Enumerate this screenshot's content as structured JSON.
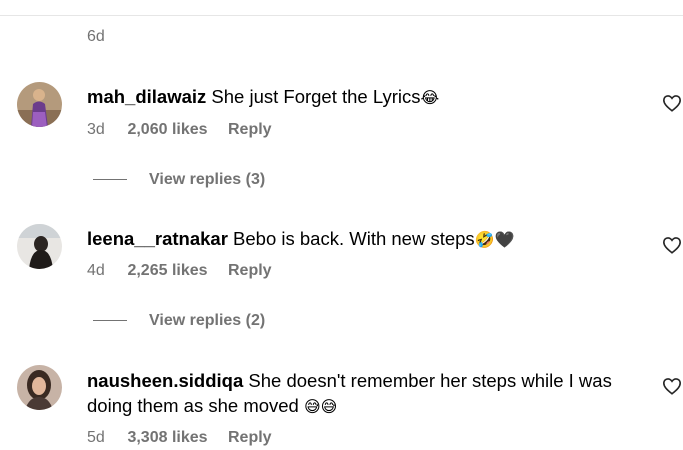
{
  "previous": {
    "time": "6d"
  },
  "comments": [
    {
      "username": "mah_dilawaiz",
      "text": "She just Forget the Lyrics",
      "emoji": "😂",
      "time": "3d",
      "likes": "2,060 likes",
      "reply": "Reply",
      "view_replies": "View replies (3)"
    },
    {
      "username": "leena__ratnakar",
      "text": "Bebo is back. With new steps",
      "emoji": "🤣🖤",
      "time": "4d",
      "likes": "2,265 likes",
      "reply": "Reply",
      "view_replies": "View replies (2)"
    },
    {
      "username": "nausheen.siddiqa",
      "text": "She doesn't remember her steps while I was doing them as she moved ",
      "emoji": "😅😅",
      "time": "5d",
      "likes": "3,308 likes",
      "reply": "Reply"
    }
  ],
  "icons": {
    "like": "heart-outline-icon"
  }
}
